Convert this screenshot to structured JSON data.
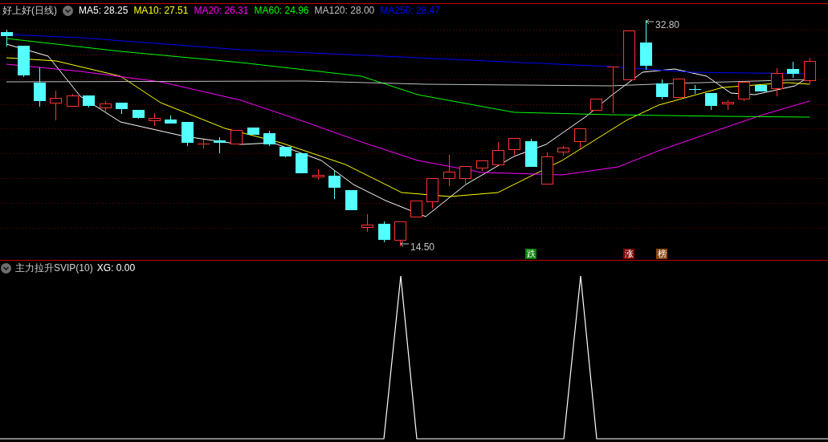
{
  "main_panel": {
    "title": "好上好(日线)",
    "indicators": [
      {
        "label": "MA5: 28.25",
        "color": "#ffffff"
      },
      {
        "label": "MA10: 27.51",
        "color": "#ffff00"
      },
      {
        "label": "MA20: 26.31",
        "color": "#ff00ff"
      },
      {
        "label": "MA60: 24.96",
        "color": "#00ff00"
      },
      {
        "label": "MA120: 28.00",
        "color": "#c0c0c0"
      },
      {
        "label": "MA250: 28.47",
        "color": "#0000ff"
      }
    ],
    "annotations": [
      {
        "kind": "high",
        "text": "32.80"
      },
      {
        "kind": "low",
        "text": "14.50"
      }
    ],
    "markers": [
      {
        "text": "跌",
        "color": "#008000"
      },
      {
        "text": "涨",
        "color": "#800000"
      },
      {
        "text": "榜",
        "color": "#8b4513"
      }
    ]
  },
  "sub_panel": {
    "title": "主力拉升SVIP(10)",
    "readings": [
      "XG: 0.00"
    ]
  }
}
